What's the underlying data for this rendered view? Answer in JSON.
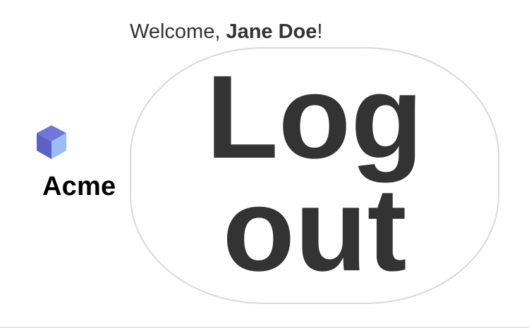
{
  "brand": {
    "name": "Acme",
    "logo_icon": "cube-logo-icon",
    "logo_colors": {
      "top": "#6f78d8",
      "left": "#5c62c4",
      "right": "#9cbcf4"
    }
  },
  "header": {
    "welcome_prefix": "Welcome, ",
    "user_name": "Jane Doe",
    "welcome_suffix": "!"
  },
  "actions": {
    "logout_label": "Log out"
  },
  "colors": {
    "text_primary": "#333333",
    "button_border": "#d9d9d9",
    "divider": "#e6e6e6",
    "background": "#ffffff"
  }
}
